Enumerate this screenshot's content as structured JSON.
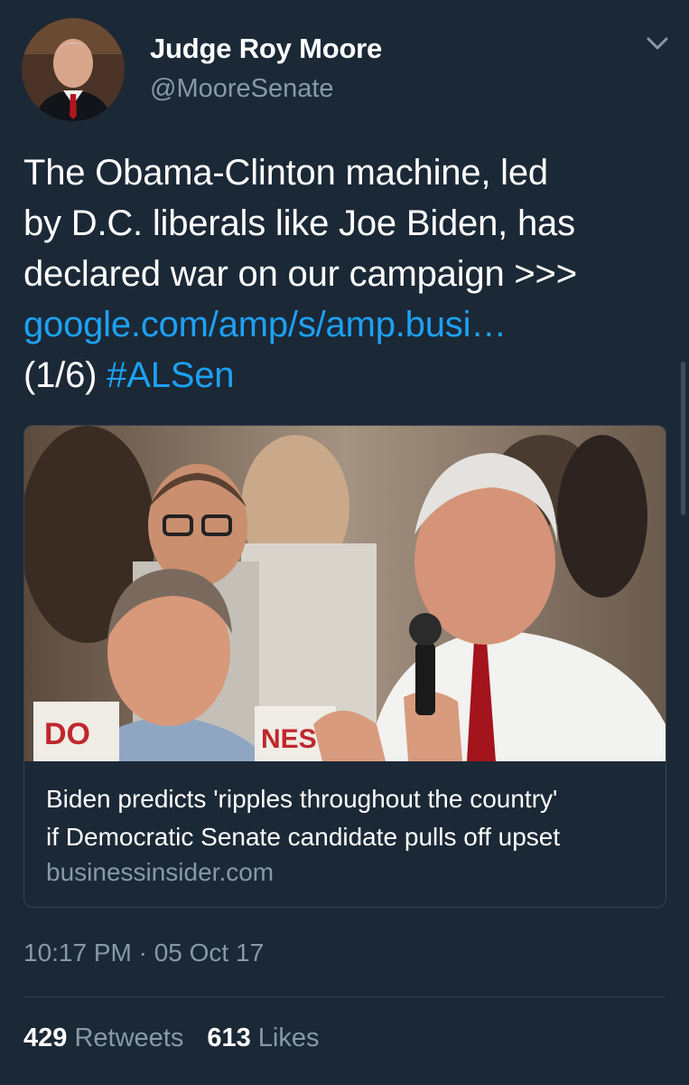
{
  "author": {
    "name": "Judge Roy Moore",
    "handle": "@MooreSenate"
  },
  "tweet": {
    "lines": [
      "The Obama-Clinton machine, led",
      "by D.C. liberals like Joe Biden, has",
      "declared war on our campaign >>>"
    ],
    "link_text": "google.com/amp/s/amp.busi…",
    "thread_marker": "(1/6)",
    "hashtag": "#ALSen"
  },
  "card": {
    "title_lines": [
      "Biden predicts 'ripples throughout the country'",
      "if Democratic Senate candidate pulls off upset"
    ],
    "domain": "businessinsider.com",
    "photo_sign_text": "DO",
    "photo_sign_text2": "NES"
  },
  "meta": {
    "timestamp": "10:17 PM · 05 Oct 17"
  },
  "stats": {
    "retweets_count": "429",
    "retweets_label": "Retweets",
    "likes_count": "613",
    "likes_label": "Likes"
  },
  "icons": {
    "menu": "chevron-down-icon"
  },
  "colors": {
    "background": "#1b2836",
    "link": "#1da1f2",
    "secondary_text": "#8899a6",
    "border": "#38444d"
  }
}
